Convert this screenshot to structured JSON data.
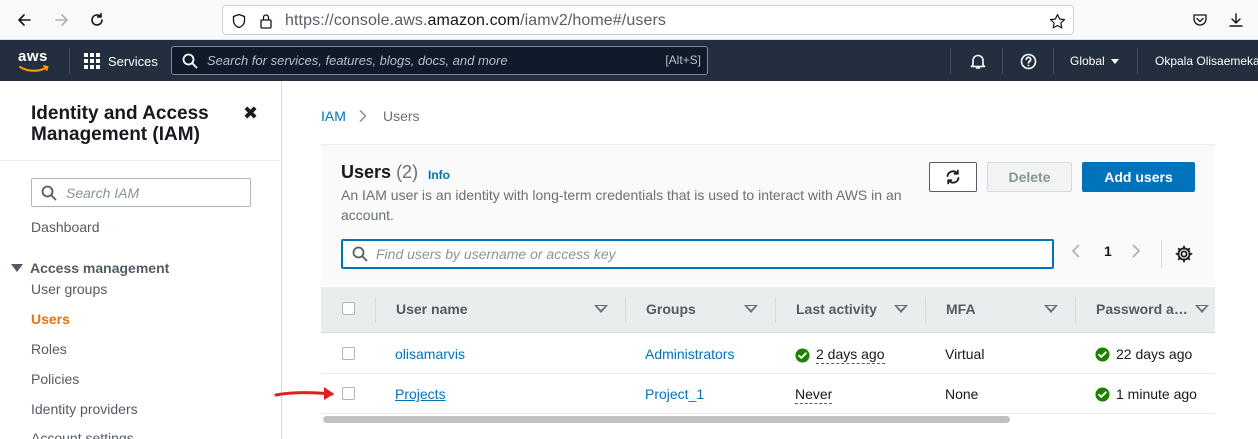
{
  "browser": {
    "url_prefix": "https://console.aws.",
    "url_domain": "amazon.com",
    "url_path": "/iamv2/home#/users"
  },
  "topnav": {
    "logo": "aws",
    "services": "Services",
    "search_placeholder": "Search for services, features, blogs, docs, and more",
    "search_shortcut": "[Alt+S]",
    "region": "Global",
    "user": "Okpala Olisaemeka"
  },
  "sidebar": {
    "title": "Identity and Access Management (IAM)",
    "search_placeholder": "Search IAM",
    "dashboard": "Dashboard",
    "section": "Access management",
    "items": [
      {
        "label": "User groups",
        "active": false
      },
      {
        "label": "Users",
        "active": true
      },
      {
        "label": "Roles",
        "active": false
      },
      {
        "label": "Policies",
        "active": false
      },
      {
        "label": "Identity providers",
        "active": false
      },
      {
        "label": "Account settings",
        "active": false
      }
    ]
  },
  "breadcrumb": {
    "root": "IAM",
    "separator": ">",
    "current": "Users"
  },
  "panel": {
    "title": "Users",
    "count": "(2)",
    "info": "Info",
    "description": "An IAM user is an identity with long-term credentials that is used to interact with AWS in an account.",
    "delete_label": "Delete",
    "add_label": "Add users",
    "filter_placeholder": "Find users by username or access key",
    "page": "1"
  },
  "table": {
    "columns": [
      "User name",
      "Groups",
      "Last activity",
      "MFA",
      "Password a…"
    ],
    "rows": [
      {
        "user": "olisamarvis",
        "group": "Administrators",
        "last_activity": "2 days ago",
        "last_activity_ok": true,
        "mfa": "Virtual",
        "password_age": "22 days ago"
      },
      {
        "user": "Projects",
        "group": "Project_1",
        "last_activity": "Never",
        "last_activity_ok": false,
        "mfa": "None",
        "password_age": "1 minute ago"
      }
    ]
  },
  "colors": {
    "aws_nav": "#232f3e",
    "link": "#0073bb",
    "active_nav": "#ec7211",
    "success": "#1d8102",
    "annotation": "#e02020"
  }
}
